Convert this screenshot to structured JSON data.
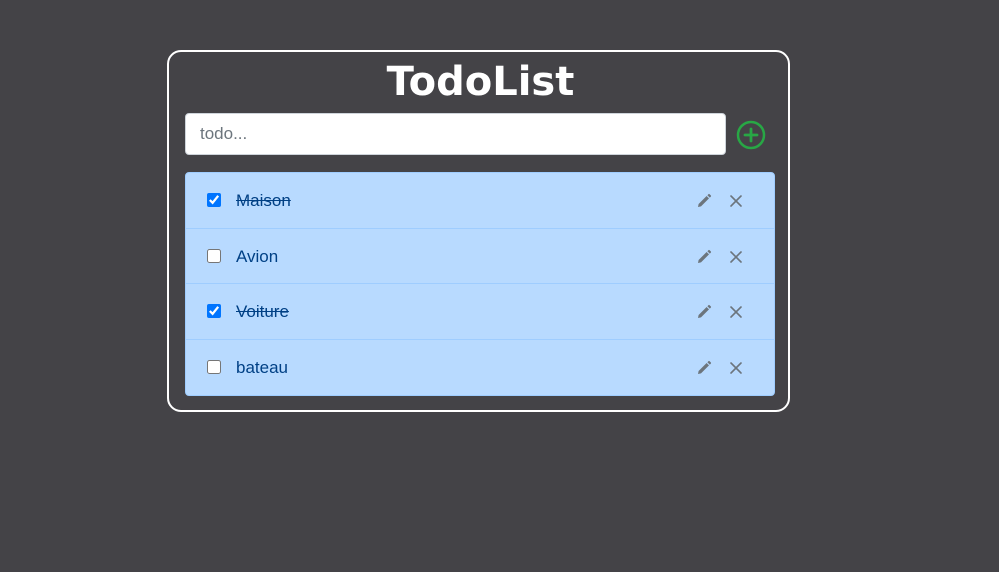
{
  "app": {
    "title": "TodoList"
  },
  "input": {
    "placeholder": "todo...",
    "value": ""
  },
  "add_button": {
    "icon": "plus-circle-icon",
    "color": "#28a745"
  },
  "colors": {
    "background": "#444347",
    "card_border": "#ffffff",
    "list_background": "#b8daff",
    "list_text": "#004085",
    "icon_gray": "#6c757d"
  },
  "todos": [
    {
      "label": "Maison",
      "done": true
    },
    {
      "label": "Avion",
      "done": false
    },
    {
      "label": "Voiture",
      "done": true
    },
    {
      "label": "bateau",
      "done": false
    }
  ],
  "item_actions": {
    "edit_icon": "pencil-icon",
    "delete_icon": "close-icon"
  }
}
